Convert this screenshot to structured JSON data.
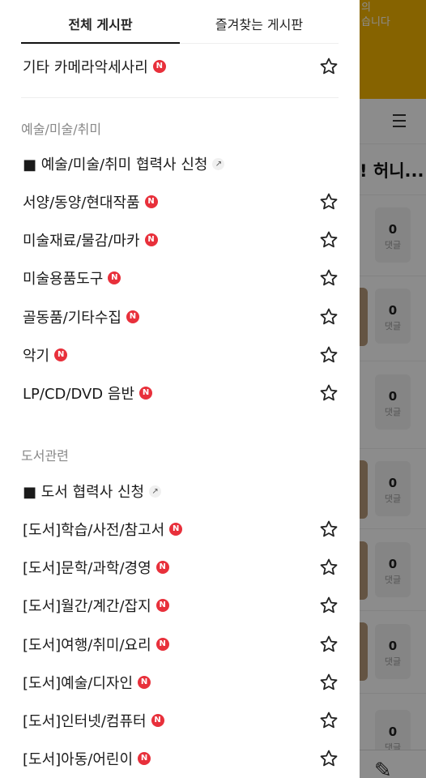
{
  "background": {
    "banner_text": "습니다",
    "banner_text_top": "의",
    "partial_title": "! 허니...",
    "count_label": "댓글",
    "counts": [
      "0",
      "0",
      "0",
      "0",
      "0",
      "0",
      "0"
    ],
    "colors": {
      "banner": "#f4b400"
    }
  },
  "tabs": [
    {
      "label": "전체 게시판",
      "active": true
    },
    {
      "label": "즐겨찾는 게시판",
      "active": false
    }
  ],
  "top_item": {
    "label": "기타 카메라악세사리",
    "new": "N"
  },
  "section_art": {
    "heading": "예술/미술/취미",
    "partner_link": "■ 예술/미술/취미 협력사 신청",
    "items": [
      {
        "label": "서양/동양/현대작품",
        "new": "N"
      },
      {
        "label": "미술재료/물감/마카",
        "new": "N"
      },
      {
        "label": "미술용품도구",
        "new": "N"
      },
      {
        "label": "골동품/기타수집",
        "new": "N"
      },
      {
        "label": "악기",
        "new": "N"
      },
      {
        "label": "LP/CD/DVD 음반",
        "new": "N"
      }
    ]
  },
  "section_books": {
    "heading": "도서관련",
    "partner_link": "■ 도서 협력사 신청",
    "items": [
      {
        "label": "[도서]학습/사전/참고서",
        "new": "N"
      },
      {
        "label": "[도서]문학/과학/경영",
        "new": "N"
      },
      {
        "label": "[도서]월간/계간/잡지",
        "new": "N"
      },
      {
        "label": "[도서]여행/취미/요리",
        "new": "N"
      },
      {
        "label": "[도서]예술/디자인",
        "new": "N"
      },
      {
        "label": "[도서]인터넷/컴퓨터",
        "new": "N"
      },
      {
        "label": "[도서]아동/어린이",
        "new": "N"
      }
    ]
  },
  "icons": {
    "star": "star-outline-icon",
    "new": "new-badge-icon",
    "link": "external-link-icon",
    "menu": "menu-icon",
    "pencil": "pencil-icon"
  },
  "colors": {
    "new_badge": "#e8303b",
    "text": "#1a1a1a",
    "section_heading": "#888888"
  }
}
